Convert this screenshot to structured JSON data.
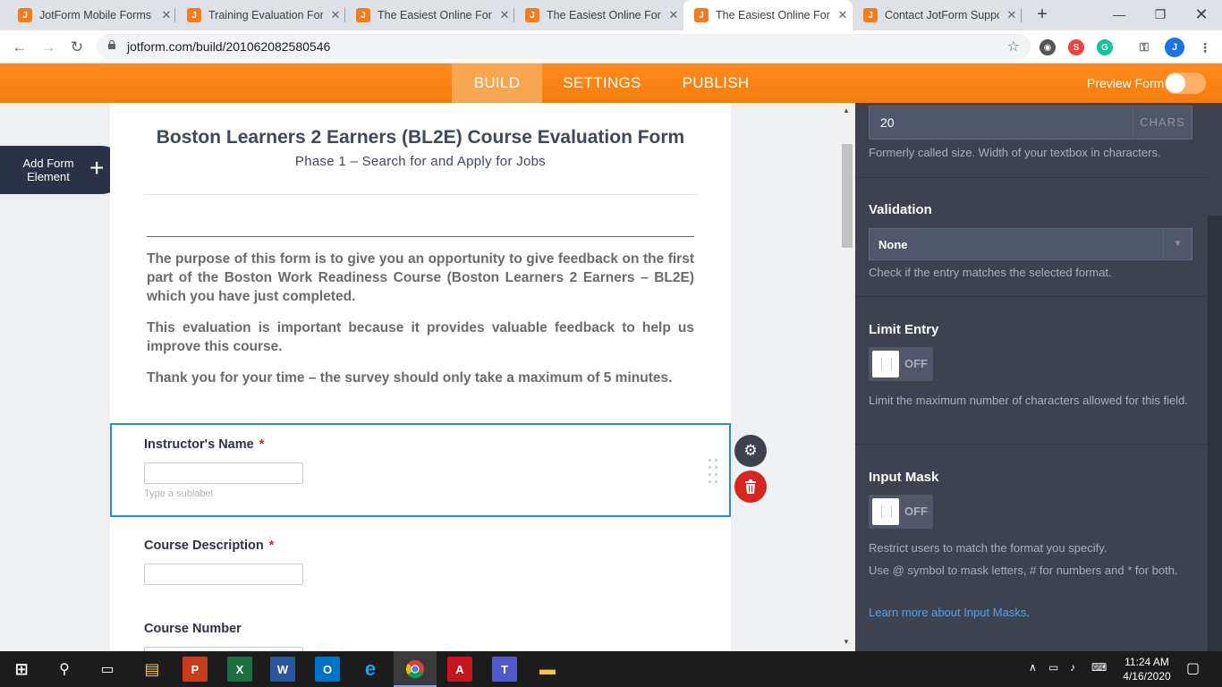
{
  "browser": {
    "tabs": [
      {
        "title": "JotForm Mobile Forms",
        "close": "✕"
      },
      {
        "title": "Training Evaluation Form",
        "close": "✕"
      },
      {
        "title": "The Easiest Online Form",
        "close": "✕"
      },
      {
        "title": "The Easiest Online Form",
        "close": "✕"
      },
      {
        "title": "The Easiest Online Form",
        "close": "✕"
      },
      {
        "title": "Contact JotForm Support",
        "close": "✕"
      }
    ],
    "new_tab": "+",
    "url": "jotform.com/build/201062082580546",
    "profile_initial": "J"
  },
  "appbar": {
    "tabs": [
      "BUILD",
      "SETTINGS",
      "PUBLISH"
    ],
    "preview_label": "Preview Form"
  },
  "sidebar": {
    "add_element_label": "Add Form Element",
    "add_icon": "+"
  },
  "form": {
    "title": "Boston Learners 2 Earners (BL2E) Course Evaluation Form",
    "subtitle": "Phase 1 – Search for and Apply for Jobs",
    "paragraphs": [
      "The purpose of this form is to give you an opportunity to give feedback on the first part of the Boston Work Readiness Course (Boston Learners 2 Earners – BL2E) which you have just completed.",
      "This evaluation is important because it provides valuable feedback to help us improve this course.",
      "Thank you for your time – the survey should only take a maximum of 5 minutes."
    ],
    "fields": [
      {
        "label": "Instructor's Name",
        "required": "*",
        "sublabel_placeholder": "Type a sublabel"
      },
      {
        "label": "Course Description",
        "required": "*"
      },
      {
        "label": "Course Number"
      }
    ]
  },
  "properties": {
    "width_value": "20",
    "width_unit": "CHARS",
    "width_desc": "Formerly called size. Width of your textbox in characters.",
    "validation": {
      "heading": "Validation",
      "value": "None",
      "desc": "Check if the entry matches the selected format."
    },
    "limit_entry": {
      "heading": "Limit Entry",
      "toggle": "OFF",
      "desc": "Limit the maximum number of characters allowed for this field."
    },
    "input_mask": {
      "heading": "Input Mask",
      "toggle": "OFF",
      "desc1": "Restrict users to match the format you specify.",
      "desc2": "Use @ symbol to mask letters, # for numbers and * for both.",
      "link": "Learn more about Input Masks",
      "link_suffix": "."
    }
  },
  "taskbar": {
    "time": "11:24 AM",
    "date": "4/16/2020"
  },
  "colors": {
    "accent": "#f57d0f",
    "panel": "#3d4250",
    "selected_border": "#2a8ec8",
    "delete": "#d6261f"
  }
}
